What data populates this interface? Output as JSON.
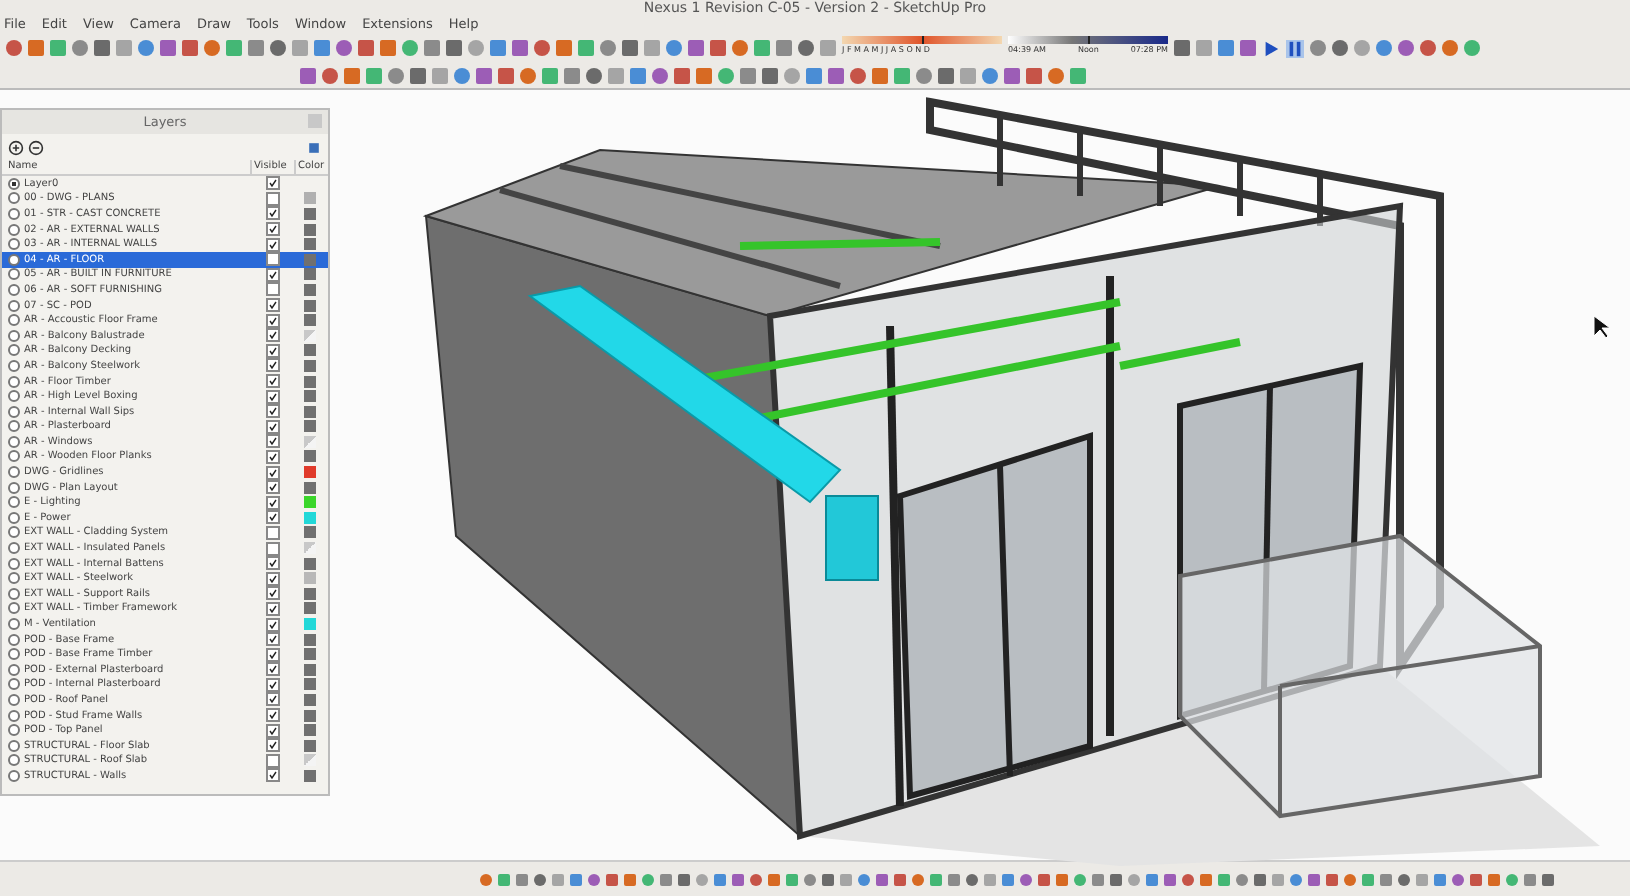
{
  "window": {
    "title": "Nexus 1 Revision C-05 - Version 2 - SketchUp Pro"
  },
  "menu": [
    "File",
    "Edit",
    "View",
    "Camera",
    "Draw",
    "Tools",
    "Window",
    "Extensions",
    "Help"
  ],
  "shadow_settings": {
    "date_slider": {
      "level": 0.5,
      "months": "J F M A M J J A S O N D"
    },
    "time_slider": {
      "level": 0.5,
      "time_start": "04:39 AM",
      "time_mid": "Noon",
      "time_end": "07:28 PM"
    }
  },
  "layers_panel": {
    "title": "Layers",
    "columns": [
      "Name",
      "Visible",
      "Color"
    ],
    "layers": [
      {
        "name": "Layer0",
        "current": true,
        "selected": false,
        "visible": true
      },
      {
        "name": "00 - DWG - PLANS",
        "current": false,
        "selected": false,
        "visible": false,
        "color": "#b0b0b0",
        "textured": false
      },
      {
        "name": "01 - STR - CAST CONCRETE",
        "current": false,
        "selected": false,
        "visible": true,
        "color": "#707070",
        "textured": false
      },
      {
        "name": "02 - AR - EXTERNAL WALLS",
        "current": false,
        "selected": false,
        "visible": true,
        "color": "#707070",
        "textured": false
      },
      {
        "name": "03 - AR - INTERNAL WALLS",
        "current": false,
        "selected": false,
        "visible": true,
        "color": "#707070",
        "textured": false
      },
      {
        "name": "04 - AR - FLOOR",
        "current": false,
        "selected": true,
        "visible": false,
        "color": "#707070",
        "textured": false
      },
      {
        "name": "05 - AR - BUILT IN FURNITURE",
        "current": false,
        "selected": false,
        "visible": true,
        "color": "#707070",
        "textured": false
      },
      {
        "name": "06 - AR - SOFT FURNISHING",
        "current": false,
        "selected": false,
        "visible": false,
        "color": "#707070",
        "textured": false
      },
      {
        "name": "07 - SC - POD",
        "current": false,
        "selected": false,
        "visible": true,
        "color": "#707070",
        "textured": false
      },
      {
        "name": "AR - Accoustic Floor Frame",
        "current": false,
        "selected": false,
        "visible": true,
        "color": "#707070",
        "textured": false
      },
      {
        "name": "AR - Balcony Balustrade",
        "current": false,
        "selected": false,
        "visible": true,
        "color": "#c8c8c8",
        "textured": true
      },
      {
        "name": "AR - Balcony Decking",
        "current": false,
        "selected": false,
        "visible": true,
        "color": "#707070",
        "textured": false
      },
      {
        "name": "AR - Balcony Steelwork",
        "current": false,
        "selected": false,
        "visible": true,
        "color": "#707070",
        "textured": false
      },
      {
        "name": "AR - Floor Timber",
        "current": false,
        "selected": false,
        "visible": true,
        "color": "#707070",
        "textured": false
      },
      {
        "name": "AR - High Level Boxing",
        "current": false,
        "selected": false,
        "visible": true,
        "color": "#707070",
        "textured": false
      },
      {
        "name": "AR - Internal Wall Sips",
        "current": false,
        "selected": false,
        "visible": true,
        "color": "#707070",
        "textured": false
      },
      {
        "name": "AR - Plasterboard",
        "current": false,
        "selected": false,
        "visible": true,
        "color": "#707070",
        "textured": false
      },
      {
        "name": "AR - Windows",
        "current": false,
        "selected": false,
        "visible": true,
        "color": "#c8c8c8",
        "textured": true
      },
      {
        "name": "AR - Wooden Floor Planks",
        "current": false,
        "selected": false,
        "visible": true,
        "color": "#707070",
        "textured": false
      },
      {
        "name": "DWG - Gridlines",
        "current": false,
        "selected": false,
        "visible": true,
        "color": "#e03a2a",
        "textured": false
      },
      {
        "name": "DWG - Plan Layout",
        "current": false,
        "selected": false,
        "visible": true,
        "color": "#707070",
        "textured": false
      },
      {
        "name": "E - Lighting",
        "current": false,
        "selected": false,
        "visible": true,
        "color": "#3ad62a",
        "textured": false
      },
      {
        "name": "E - Power",
        "current": false,
        "selected": false,
        "visible": true,
        "color": "#22d8d8",
        "textured": false
      },
      {
        "name": "EXT WALL - Cladding System",
        "current": false,
        "selected": false,
        "visible": false,
        "color": "#707070",
        "textured": false
      },
      {
        "name": "EXT WALL - Insulated Panels",
        "current": false,
        "selected": false,
        "visible": false,
        "color": "#c8c8c8",
        "textured": true
      },
      {
        "name": "EXT WALL - Internal Battens",
        "current": false,
        "selected": false,
        "visible": true,
        "color": "#707070",
        "textured": false
      },
      {
        "name": "EXT WALL - Steelwork",
        "current": false,
        "selected": false,
        "visible": true,
        "color": "#b8b8b8",
        "textured": false
      },
      {
        "name": "EXT WALL - Support Rails",
        "current": false,
        "selected": false,
        "visible": true,
        "color": "#707070",
        "textured": false
      },
      {
        "name": "EXT WALL - Timber Framework",
        "current": false,
        "selected": false,
        "visible": true,
        "color": "#707070",
        "textured": false
      },
      {
        "name": "M - Ventilation",
        "current": false,
        "selected": false,
        "visible": true,
        "color": "#22d8d8",
        "textured": false
      },
      {
        "name": "POD - Base Frame",
        "current": false,
        "selected": false,
        "visible": true,
        "color": "#707070",
        "textured": false
      },
      {
        "name": "POD - Base Frame Timber",
        "current": false,
        "selected": false,
        "visible": true,
        "color": "#707070",
        "textured": false
      },
      {
        "name": "POD - External Plasterboard",
        "current": false,
        "selected": false,
        "visible": true,
        "color": "#707070",
        "textured": false
      },
      {
        "name": "POD - Internal Plasterboard",
        "current": false,
        "selected": false,
        "visible": true,
        "color": "#707070",
        "textured": false
      },
      {
        "name": "POD - Roof Panel",
        "current": false,
        "selected": false,
        "visible": true,
        "color": "#707070",
        "textured": false
      },
      {
        "name": "POD - Stud Frame Walls",
        "current": false,
        "selected": false,
        "visible": true,
        "color": "#707070",
        "textured": false
      },
      {
        "name": "POD - Top Panel",
        "current": false,
        "selected": false,
        "visible": true,
        "color": "#707070",
        "textured": false
      },
      {
        "name": "STRUCTURAL - Floor Slab",
        "current": false,
        "selected": false,
        "visible": true,
        "color": "#707070",
        "textured": false
      },
      {
        "name": "STRUCTURAL - Roof Slab",
        "current": false,
        "selected": false,
        "visible": false,
        "color": "#c8c8c8",
        "textured": true
      },
      {
        "name": "STRUCTURAL - Walls",
        "current": false,
        "selected": false,
        "visible": true,
        "color": "#707070",
        "textured": false
      }
    ]
  }
}
